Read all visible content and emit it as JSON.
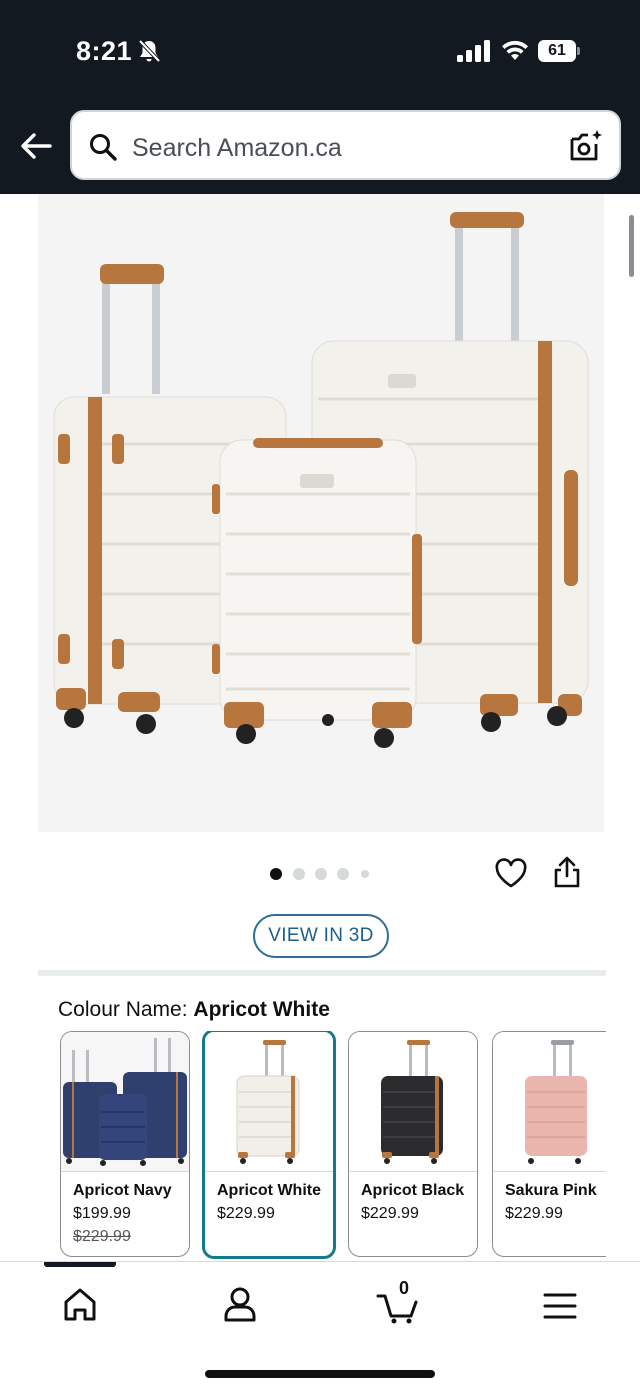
{
  "status_bar": {
    "time": "8:21",
    "battery": "61",
    "icons": [
      "bell-muted-icon",
      "signal-icon",
      "wifi-icon",
      "battery-icon"
    ]
  },
  "header": {
    "back_icon": "arrow-left-icon",
    "search_placeholder": "Search Amazon.ca",
    "search_icon": "search-icon",
    "camera_icon": "camera-icon"
  },
  "product": {
    "image_alt": "three-piece-luggage-set",
    "carousel": {
      "count": 5,
      "active_index": 0
    },
    "view_3d_label": "VIEW IN 3D"
  },
  "colour": {
    "label": "Colour Name:",
    "selected": "Apricot White",
    "options": [
      {
        "name": "Apricot Navy",
        "price": "$199.99",
        "list_price": "$229.99",
        "color": "#2f3f6e",
        "selected": false
      },
      {
        "name": "Apricot White",
        "price": "$229.99",
        "list_price": "",
        "color": "#f2efea",
        "selected": true
      },
      {
        "name": "Apricot Black",
        "price": "$229.99",
        "list_price": "",
        "color": "#2c2c2e",
        "selected": false
      },
      {
        "name": "Sakura Pink",
        "price": "$229.99",
        "list_price": "",
        "color": "#e9b5ad",
        "selected": false
      }
    ]
  },
  "bottom_nav": {
    "items": [
      "home-icon",
      "account-icon",
      "cart-icon",
      "menu-icon"
    ],
    "cart_count": "0"
  },
  "colors": {
    "header_bg": "#131921",
    "trim_brown": "#b8763f",
    "selected_teal": "#127b8b",
    "link_blue": "#1c5f88"
  }
}
